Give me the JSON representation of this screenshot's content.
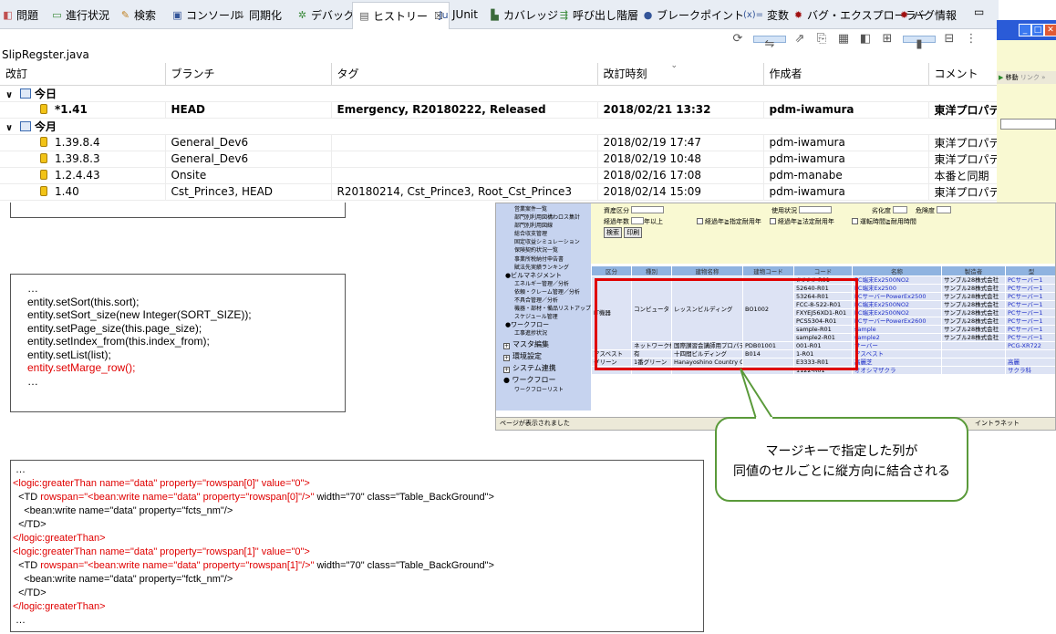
{
  "tabs": [
    {
      "label": "問題",
      "icon": "problems-icon",
      "glyph": "◧",
      "color": "#c05050"
    },
    {
      "label": "進行状況",
      "icon": "progress-icon",
      "glyph": "▭",
      "color": "#3a8a3a"
    },
    {
      "label": "検索",
      "icon": "search-icon",
      "glyph": "✎",
      "color": "#c08020"
    },
    {
      "label": "コンソール",
      "icon": "console-icon",
      "glyph": "▣",
      "color": "#335599"
    },
    {
      "label": "同期化",
      "icon": "synchronize-icon",
      "glyph": "⇅",
      "color": "#444444"
    },
    {
      "label": "デバッグ",
      "icon": "debug-icon",
      "glyph": "✲",
      "color": "#3a8a3a"
    },
    {
      "label": "ヒストリー",
      "icon": "history-icon",
      "glyph": "▤",
      "color": "#555555",
      "active": true,
      "close": "☒"
    },
    {
      "label": "JUnit",
      "icon": "junit-icon",
      "glyph": "Ju",
      "color": "#335599"
    },
    {
      "label": "カバレッジ",
      "icon": "coverage-icon",
      "glyph": "▙",
      "color": "#3a6a3a"
    },
    {
      "label": "呼び出し階層",
      "icon": "call-hierarchy-icon",
      "glyph": "⇶",
      "color": "#3a8a3a"
    },
    {
      "label": "ブレークポイント",
      "icon": "breakpoint-icon",
      "glyph": "●",
      "color": "#335599"
    },
    {
      "label": "変数",
      "icon": "variables-icon",
      "glyph": "(x)=",
      "color": "#335599"
    },
    {
      "label": "バグ・エクスプローラー",
      "icon": "bug-explorer-icon",
      "glyph": "✹",
      "color": "#a01010"
    },
    {
      "label": "バグ情報",
      "icon": "bug-info-icon",
      "glyph": "✹",
      "color": "#a01010"
    }
  ],
  "filename": "SlipRegster.java",
  "history": {
    "columns": [
      "改訂",
      "ブランチ",
      "タグ",
      "改訂時刻",
      "作成者",
      "コメント"
    ],
    "groups": [
      {
        "label": "今日",
        "rows": [
          {
            "rev": "*1.41",
            "branch": "HEAD",
            "tag": "Emergency, R20180222, Released",
            "time": "2018/02/21 13:32",
            "author": "pdm-iwamura",
            "comment": "東洋プロパティ",
            "bold": true
          }
        ]
      },
      {
        "label": "今月",
        "rows": [
          {
            "rev": "1.39.8.4",
            "branch": "General_Dev6",
            "tag": "",
            "time": "2018/02/19 17:47",
            "author": "pdm-iwamura",
            "comment": "東洋プロパティ"
          },
          {
            "rev": "1.39.8.3",
            "branch": "General_Dev6",
            "tag": "",
            "time": "2018/02/19 10:48",
            "author": "pdm-iwamura",
            "comment": "東洋プロパティ"
          },
          {
            "rev": "1.2.4.43",
            "branch": "Onsite",
            "tag": "",
            "time": "2018/02/16 17:08",
            "author": "pdm-manabe",
            "comment": "本番と同期"
          },
          {
            "rev": "1.40",
            "branch": "Cst_Prince3, HEAD",
            "tag": "R20180214, Cst_Prince3, Root_Cst_Prince3",
            "time": "2018/02/14 15:09",
            "author": "pdm-iwamura",
            "comment": "東洋プロパティ"
          }
        ]
      }
    ]
  },
  "code1": [
    {
      "text": "…",
      "red": false
    },
    {
      "text": "entity.setSort(this.sort);",
      "red": false
    },
    {
      "text": "entity.setSort_size(new Integer(SORT_SIZE));",
      "red": false
    },
    {
      "text": "entity.setPage_size(this.page_size);",
      "red": false
    },
    {
      "text": "entity.setIndex_from(this.index_from);",
      "red": false
    },
    {
      "text": "entity.setList(list);",
      "red": false
    },
    {
      "text": "entity.setMarge_row();",
      "red": true
    },
    {
      "text": "…",
      "red": false
    }
  ],
  "code2": [
    [
      {
        "t": " …"
      }
    ],
    [
      {
        "t": "<logic:greaterThan name=\"data\" property=\"rowspan[0]\" value=\"0\">",
        "red": true
      }
    ],
    [
      {
        "t": "  <TD "
      },
      {
        "t": "rowspan=\"<bean:write name=\"data\" property=\"rowspan[0]\"/>\"",
        "red": true
      },
      {
        "t": " width=\"70\" class=\"Table_BackGround\">"
      }
    ],
    [
      {
        "t": "    <bean:write name=\"data\" property=\"fcts_nm\"/>"
      }
    ],
    [
      {
        "t": "  </TD>"
      }
    ],
    [
      {
        "t": "</logic:greaterThan>",
        "red": true
      }
    ],
    [
      {
        "t": "<logic:greaterThan name=\"data\" property=\"rowspan[1]\" value=\"0\">",
        "red": true
      }
    ],
    [
      {
        "t": "  <TD "
      },
      {
        "t": "rowspan=\"<bean:write name=\"data\" property=\"rowspan[1]\"/>\"",
        "red": true
      },
      {
        "t": " width=\"70\" class=\"Table_BackGround\">"
      }
    ],
    [
      {
        "t": "    <bean:write name=\"data\" property=\"fctk_nm\"/>"
      }
    ],
    [
      {
        "t": "  </TD>"
      }
    ],
    [
      {
        "t": "</logic:greaterThan>",
        "red": true
      }
    ],
    [
      {
        "t": " …"
      }
    ]
  ],
  "browser": {
    "sidebar": [
      {
        "t": "営業案件一覧"
      },
      {
        "t": "部門別利用図構わロス集計"
      },
      {
        "t": "部門別利用図線"
      },
      {
        "t": "総合収支管理"
      },
      {
        "t": "固定収益シミュレーション"
      },
      {
        "t": "保険契約状況一覧"
      },
      {
        "t": "事業所税納付申告書"
      },
      {
        "t": "賦法先実績ランキング"
      },
      {
        "t": "●ビルマネジメント",
        "b": true
      },
      {
        "t": "エネルギー管理／分析"
      },
      {
        "t": "依頼・クレーム管理／分析"
      },
      {
        "t": "不具合管理／分析"
      },
      {
        "t": "機器・部材・備品リストアップ"
      },
      {
        "t": "スケジュール管理"
      },
      {
        "t": "●ワークフロー",
        "b": true
      },
      {
        "t": "工事進捗状況"
      },
      {
        "t": "マスタ編集",
        "big": true,
        "box": "+"
      },
      {
        "t": "環境設定",
        "big": true,
        "box": "+"
      },
      {
        "t": "システム連携",
        "big": true,
        "box": "+"
      },
      {
        "t": "● ワークフロー",
        "big": true
      },
      {
        "t": "ワークフローリスト"
      }
    ],
    "form": {
      "asset_label": "資産区分",
      "usage_label": "使用状況",
      "deterioration_label": "劣化度",
      "danger_label": "危険度",
      "years_label": "経過年数",
      "years_unit": "年以上",
      "check1": "経過年≧指定耐用年",
      "check2": "経過年≧法定耐用年",
      "check3": "運転時間≧耐用時間",
      "search_btn": "検索",
      "print_btn": "印刷"
    },
    "table": {
      "headers": [
        "区分",
        "種別",
        "建物名称",
        "建物コード",
        "コード",
        "名称",
        "製造者",
        "型"
      ],
      "rows": [
        [
          "",
          "",
          "",
          "",
          "####-R01",
          "PC端末Ex2500NO2",
          "サンプル28株式会社",
          "PCサーバー1"
        ],
        [
          "",
          "",
          "",
          "",
          "52640-R01",
          "PC端末Ex2500",
          "サンプル28株式会社",
          "PCサーバー1"
        ],
        [
          "",
          "",
          "",
          "",
          "53264-R01",
          "PCサーバーPowerEx2500",
          "サンプル28株式会社",
          "PCサーバー1"
        ],
        [
          "IT機器",
          "コンピュータ",
          "レッスンビルディング",
          "BO1002",
          "FCC-8-522-R01",
          "PC端末Ex2500NO2",
          "サンプル28株式会社",
          "PCサーバー1"
        ],
        [
          "",
          "",
          "",
          "",
          "FXYEJ56XD1-R01",
          "PC端末Ex2500NO2",
          "サンプル28株式会社",
          "PCサーバー1"
        ],
        [
          "",
          "",
          "",
          "",
          "PCS5304-R01",
          "PCサーバーPowerEx2600",
          "サンプル28株式会社",
          "PCサーバー1"
        ],
        [
          "",
          "",
          "",
          "",
          "sample-R01",
          "sample",
          "サンプル28株式会社",
          "PCサーバー1"
        ],
        [
          "",
          "",
          "",
          "",
          "sample2-R01",
          "sample2",
          "サンプル28株式会社",
          "PCサーバー1"
        ],
        [
          "",
          "ネットワーク機器",
          "国際讃習会講師用プロパティビル 本館",
          "PDB01001",
          "001-R01",
          "サーバー",
          "",
          "PCG-XR722"
        ],
        [
          "アスベスト",
          "有",
          "十四間ビルディング",
          "B014",
          "1-R01",
          "アスベスト",
          "",
          ""
        ],
        [
          "グリーン",
          "1番グリーン",
          "Hanayoshino Country Club",
          "",
          "E3333-R01",
          "高麗芝",
          "",
          "高麗"
        ],
        [
          "",
          "",
          "",
          "",
          "1122-R01",
          "オオシマザクラ",
          "",
          "サクラ科"
        ]
      ]
    },
    "status": "ページが表示されました",
    "zone": "イントラネット"
  },
  "ie": {
    "nav_move": "移動",
    "nav_link": "リンク »"
  },
  "callout": {
    "line1": "マージキーで指定した列が",
    "line2": "同値のセルごとに縦方向に結合される"
  },
  "colors": {
    "accent_red": "#e00000",
    "callout_green": "#5a9a3a",
    "grid_blue": "#8fb3e0"
  }
}
